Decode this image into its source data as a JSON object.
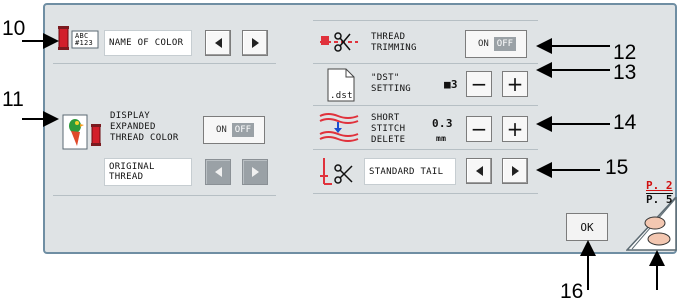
{
  "left": {
    "name_of_color": "NAME OF COLOR",
    "color_icon_text_1": "ABC",
    "color_icon_text_2": "#123",
    "display_expanded_1": "DISPLAY",
    "display_expanded_2": "EXPANDED",
    "display_expanded_3": "THREAD COLOR",
    "toggle_on": "ON",
    "toggle_off": "OFF",
    "original_thread_1": "ORIGINAL",
    "original_thread_2": "THREAD"
  },
  "right": {
    "thread_trimming_1": "THREAD",
    "thread_trimming_2": "TRIMMING",
    "toggle_on": "ON",
    "toggle_off": "OFF",
    "dst_icon_text": ".dst",
    "dst_setting_1": "\"DST\"",
    "dst_setting_2": "SETTING",
    "dst_value": "■3",
    "short_stitch_1": "SHORT",
    "short_stitch_2": "STITCH",
    "short_stitch_3": "DELETE",
    "short_stitch_value": "0.3",
    "short_stitch_unit": "mm",
    "minus": "−",
    "plus": "+",
    "standard_tail": "STANDARD TAIL"
  },
  "ok_label": "OK",
  "pager": {
    "current": "P. 2",
    "total": "P. 5"
  },
  "callouts": {
    "c10": "10",
    "c11": "11",
    "c12": "12",
    "c13": "13",
    "c14": "14",
    "c15": "15",
    "c16": "16"
  },
  "colors": {
    "panel_bg": "#dfe3e5",
    "panel_border": "#6f8ea3",
    "disabled_button": "#9aa1a6",
    "pager_red": "#d01010"
  }
}
